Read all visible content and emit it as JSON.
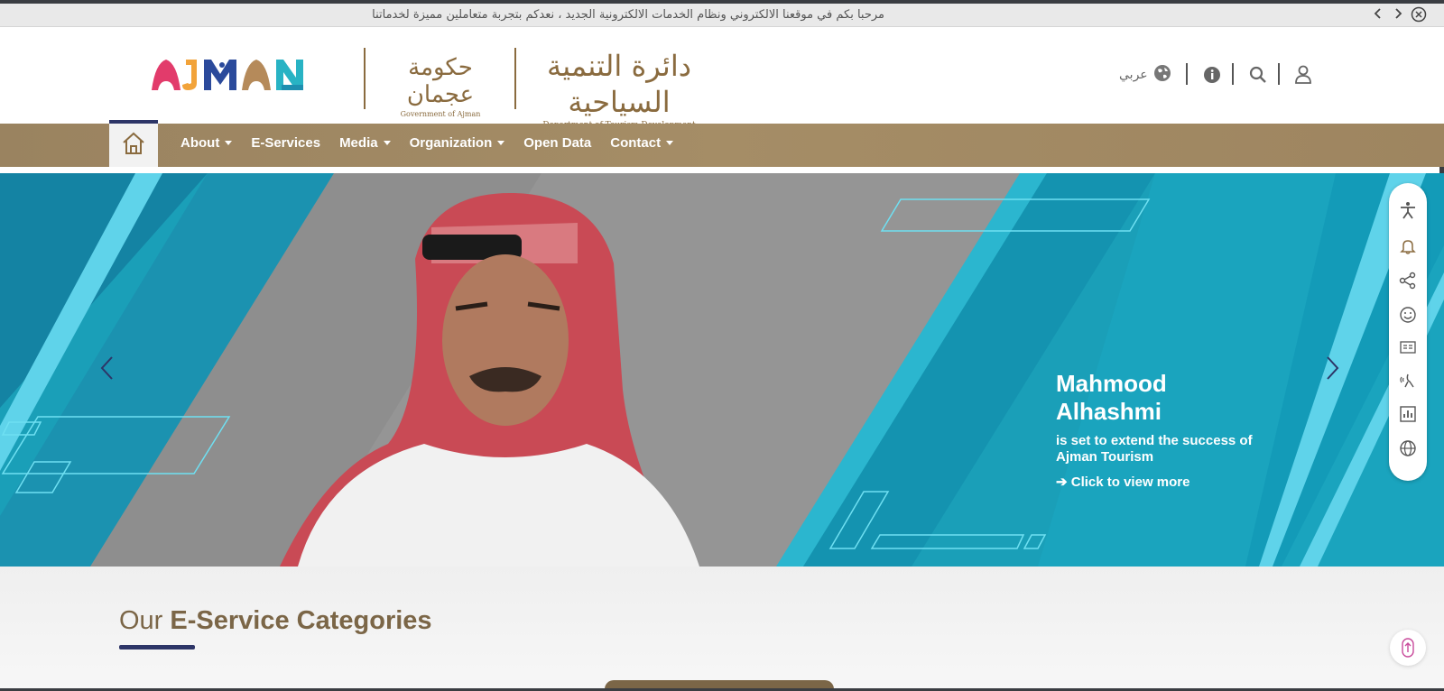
{
  "ticker": {
    "text": "مرحبا بكم في موقعنا الالكتروني ونظام الخدمات الالكترونية الجديد ، نعدكم بتجربة متعاملين مميزة لخدماتنا",
    "prev_icon": "chevron-left-icon",
    "next_icon": "chevron-right-icon",
    "close_icon": "close-circle-icon"
  },
  "header": {
    "ajman_logo": "AJMAN",
    "gov_logo_ar": "حكومة عجمان",
    "gov_logo_en": "Government of Ajman",
    "dtd_logo_ar": "دائرة التنمية السياحية",
    "dtd_logo_en": "Department of Tourism Development",
    "language_label": "عربي",
    "icons": [
      "globe-icon",
      "info-icon",
      "search-icon",
      "user-icon"
    ]
  },
  "nav": {
    "home_icon": "home-icon",
    "items": [
      {
        "label": "About",
        "dropdown": true
      },
      {
        "label": "E-Services",
        "dropdown": false
      },
      {
        "label": "Media",
        "dropdown": true
      },
      {
        "label": "Organization",
        "dropdown": true
      },
      {
        "label": "Open Data",
        "dropdown": false
      },
      {
        "label": "Contact",
        "dropdown": true
      }
    ]
  },
  "hero": {
    "title": "Mahmood Alhashmi",
    "subtitle": "is set to extend the success of Ajman Tourism",
    "link_text": "Click to view more"
  },
  "side_tools": [
    "accessibility-icon",
    "bell-icon",
    "share-icon",
    "smiley-icon",
    "reader-icon",
    "sign-language-icon",
    "stats-icon",
    "globe-icon"
  ],
  "section": {
    "title_light": "Our ",
    "title_bold": "E-Service Categories"
  },
  "colors": {
    "brand_gold": "#8a6b3f",
    "nav_brown": "#a08862",
    "accent_navy": "#2d3567",
    "hero_teal": "#1a9fb8"
  }
}
